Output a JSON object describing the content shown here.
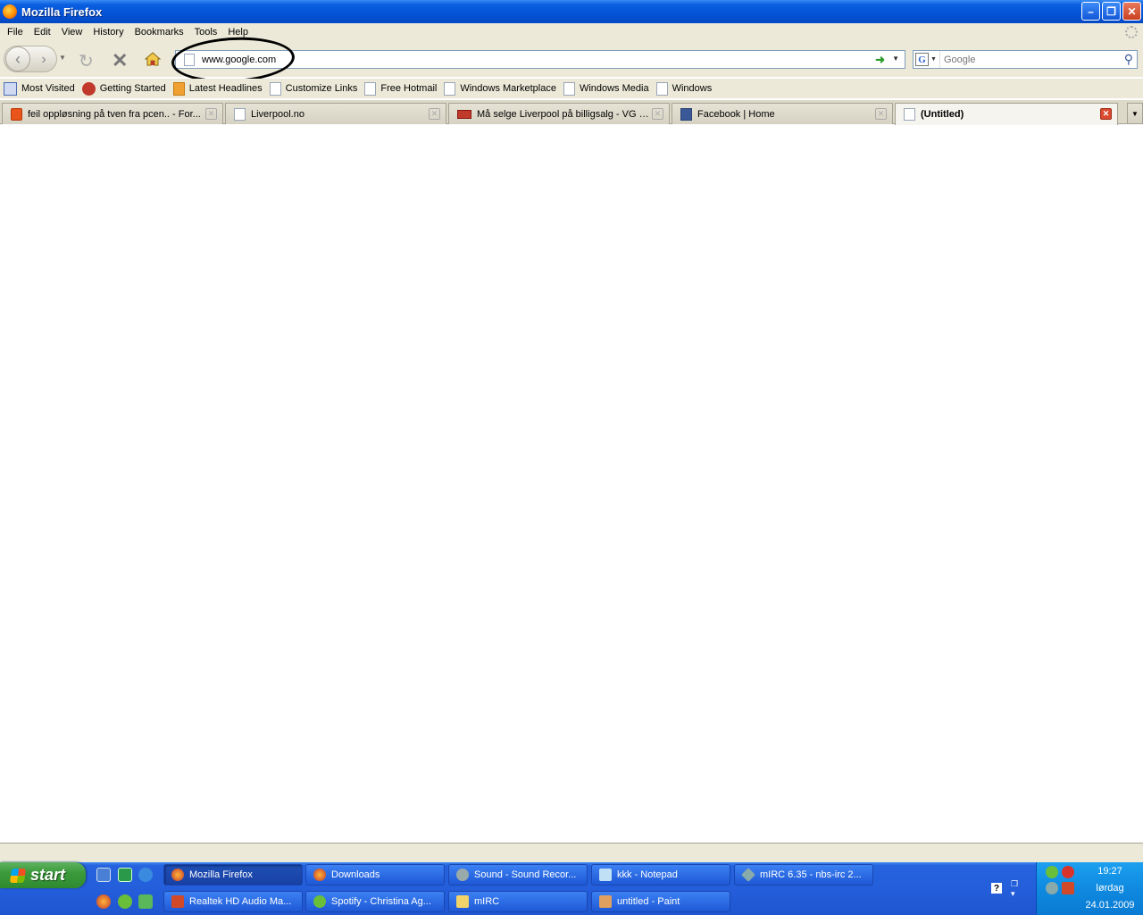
{
  "window": {
    "title": "Mozilla Firefox"
  },
  "menu": [
    "File",
    "Edit",
    "View",
    "History",
    "Bookmarks",
    "Tools",
    "Help"
  ],
  "nav": {
    "url": "www.google.com",
    "search_placeholder": "Google"
  },
  "bookmarks": [
    "Most Visited",
    "Getting Started",
    "Latest Headlines",
    "Customize Links",
    "Free Hotmail",
    "Windows Marketplace",
    "Windows Media",
    "Windows"
  ],
  "tabs": [
    {
      "label": "feil oppløsning på tven fra pcen.. - For..."
    },
    {
      "label": "Liverpool.no"
    },
    {
      "label": "Må selge Liverpool på billigsalg - VG N..."
    },
    {
      "label": "Facebook | Home"
    },
    {
      "label": "(Untitled)"
    }
  ],
  "taskbar": {
    "start_label": "start",
    "tasks_row1": [
      "Mozilla Firefox",
      "Downloads",
      "Sound - Sound Recor...",
      "kkk - Notepad",
      "mIRC 6.35 - nbs-irc 2..."
    ],
    "tasks_row2": [
      "Realtek HD Audio Ma...",
      "Spotify - Christina Ag...",
      "mIRC",
      "untitled - Paint"
    ],
    "clock": {
      "time": "19:27",
      "day": "lørdag",
      "date": "24.01.2009"
    }
  },
  "colors": {
    "titlebar": "#0553d6",
    "chrome": "#ece9d8",
    "taskbar": "#245edb",
    "start": "#3c9a3c",
    "tray": "#0f8ae0"
  }
}
